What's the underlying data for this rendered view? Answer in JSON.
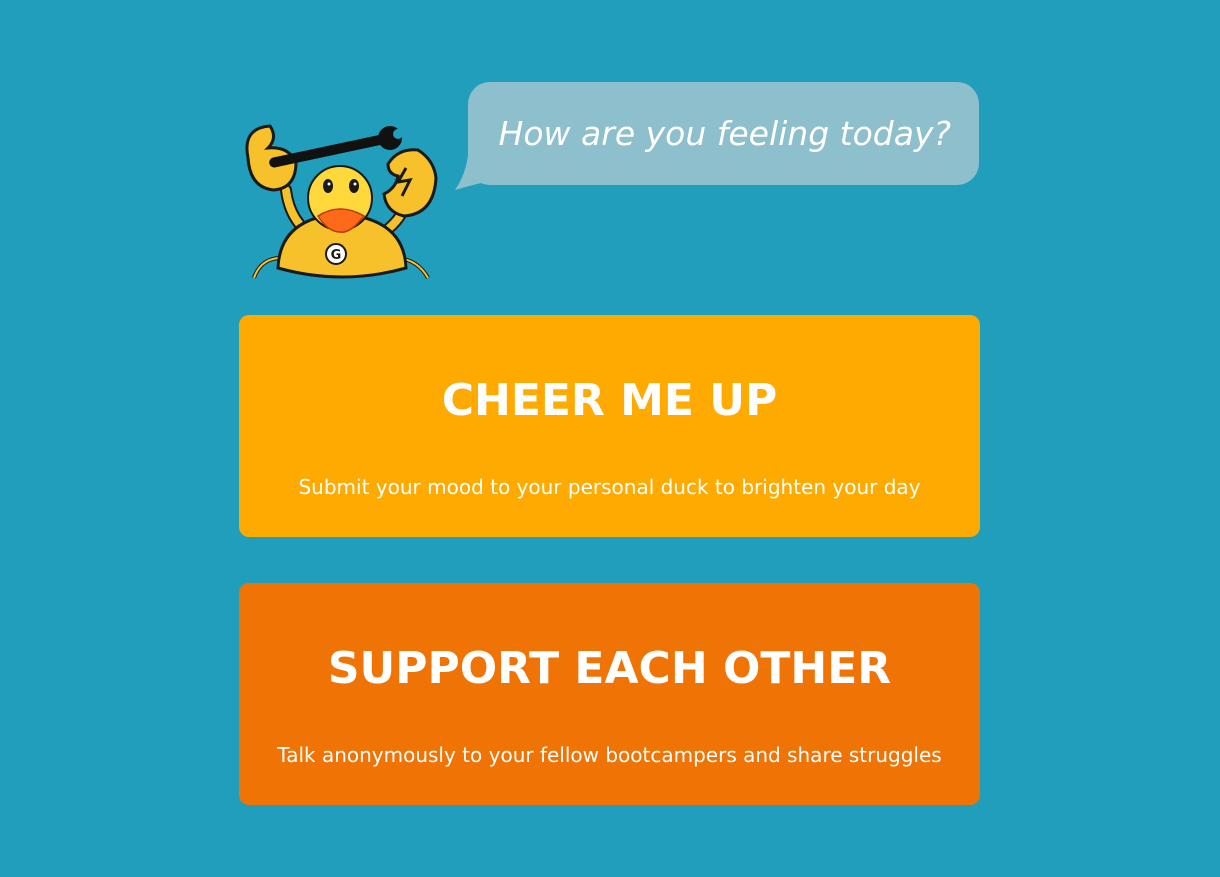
{
  "greeting": {
    "question": "How are you feeling today?"
  },
  "mascot": {
    "icon": "rubber-duck-crab-mascot-icon",
    "badge_letter": "G"
  },
  "cards": {
    "cheer": {
      "title": "CHEER ME UP",
      "description": "Submit your mood to your personal duck to brighten your day"
    },
    "support": {
      "title": "SUPPORT EACH OTHER",
      "description": "Talk anonymously to your fellow bootcampers and share struggles"
    }
  },
  "colors": {
    "background": "#219ebc",
    "bubble": "#8ebfcc",
    "cheer_card": "#ffaa00",
    "support_card": "#f07305",
    "text": "#ffffff"
  }
}
